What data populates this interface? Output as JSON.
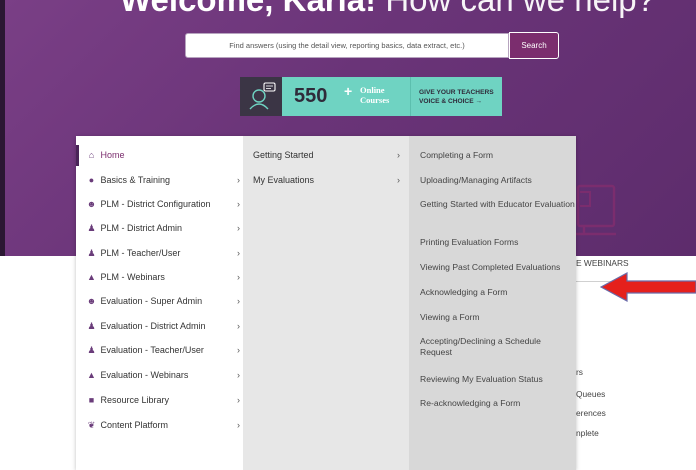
{
  "hero": {
    "title_bold": "Welcome, Karla!",
    "title_light": "How can we help?"
  },
  "search": {
    "placeholder": "Find answers (using the detail view, reporting basics, data extract, etc.)",
    "button_label": "Search"
  },
  "banner": {
    "number": "550",
    "plus": "+",
    "line1": "Online",
    "line2": "Courses",
    "cta_line1": "GIVE YOUR TEACHERS",
    "cta_line2": "VOICE & CHOICE →"
  },
  "menu": {
    "main_items": [
      {
        "label": "Home",
        "icon": "home-icon",
        "chevron": ""
      },
      {
        "label": "Basics & Training",
        "icon": "circle-icon",
        "chevron": "›"
      },
      {
        "label": "PLM - District Configuration",
        "icon": "user-gear-icon",
        "chevron": "›"
      },
      {
        "label": "PLM - District Admin",
        "icon": "user-tie-icon",
        "chevron": "›"
      },
      {
        "label": "PLM - Teacher/User",
        "icon": "user-icon",
        "chevron": "›"
      },
      {
        "label": "PLM - Webinars",
        "icon": "graduation-cap-icon",
        "chevron": "›"
      },
      {
        "label": "Evaluation - Super Admin",
        "icon": "user-gear-icon",
        "chevron": "›"
      },
      {
        "label": "Evaluation - District Admin",
        "icon": "user-tie-icon",
        "chevron": "›"
      },
      {
        "label": "Evaluation - Teacher/User",
        "icon": "user-icon",
        "chevron": "›"
      },
      {
        "label": "Evaluation - Webinars",
        "icon": "graduation-cap-icon",
        "chevron": "›"
      },
      {
        "label": "Resource Library",
        "icon": "library-icon",
        "chevron": "›"
      },
      {
        "label": "Content Platform",
        "icon": "leaf-icon",
        "chevron": "›"
      }
    ],
    "sub_items": [
      {
        "label": "Getting Started",
        "chevron": "›"
      },
      {
        "label": "My Evaluations",
        "chevron": "›"
      }
    ],
    "detail_items": [
      "Completing a Form",
      "Uploading/Managing Artifacts",
      "Getting Started with Educator Evaluation",
      "Printing Evaluation Forms",
      "Viewing Past Completed Evaluations",
      "Acknowledging a Form",
      "Viewing a Form",
      "Accepting/Declining a Schedule Request",
      "Reviewing My Evaluation Status",
      "Re-acknowledging a Form"
    ]
  },
  "right_partial": {
    "webinars": "E WEBINARS",
    "t1": "rs",
    "t2": "Queues",
    "t3": "erences",
    "t4": "nplete"
  },
  "colors": {
    "hero": "#6a3478",
    "accent": "#7b2d6e",
    "banner": "#6fd3c2",
    "arrow": "#e5201c"
  }
}
